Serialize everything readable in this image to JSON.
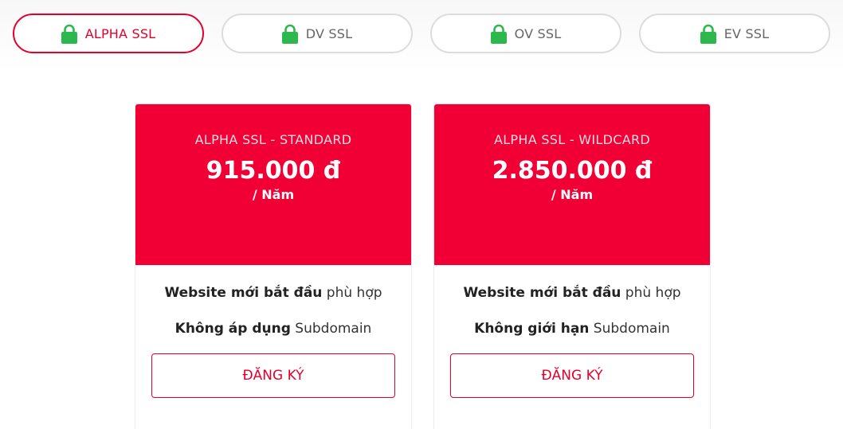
{
  "tabs": [
    {
      "label": "ALPHA SSL",
      "active": true
    },
    {
      "label": "DV SSL",
      "active": false
    },
    {
      "label": "OV SSL",
      "active": false
    },
    {
      "label": "EV SSL",
      "active": false
    }
  ],
  "colors": {
    "accent": "#e4002b",
    "card_header": "#f00034",
    "lock_icon": "#2db84d",
    "tab_border": "#dcdcdc"
  },
  "cards": [
    {
      "title": "ALPHA SSL - STANDARD",
      "price": "915.000 đ",
      "period": "/ Năm",
      "feature1_bold": "Website mới bắt đầu",
      "feature1_rest": " phù hợp",
      "feature2_bold": "Không áp dụng",
      "feature2_rest": " Subdomain",
      "button_label": "ĐĂNG KÝ"
    },
    {
      "title": "ALPHA SSL - WILDCARD",
      "price": "2.850.000 đ",
      "period": "/ Năm",
      "feature1_bold": "Website mới bắt đầu",
      "feature1_rest": " phù hợp",
      "feature2_bold": "Không giới hạn",
      "feature2_rest": " Subdomain",
      "button_label": "ĐĂNG KÝ"
    }
  ]
}
